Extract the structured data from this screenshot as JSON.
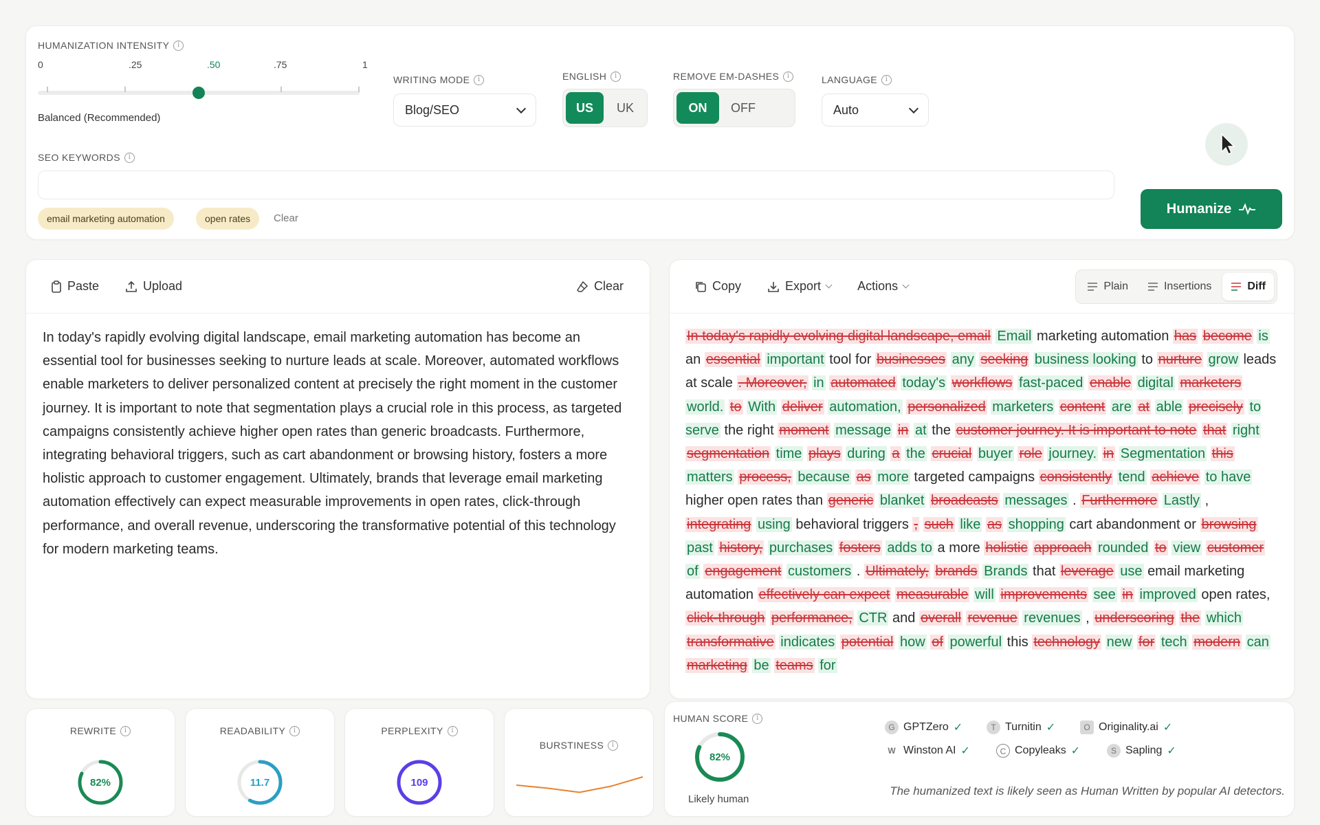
{
  "settings": {
    "intensity_label": "HUMANIZATION INTENSITY",
    "ticks": [
      "0",
      ".25",
      ".50",
      ".75",
      "1"
    ],
    "intensity_value": 0.5,
    "intensity_desc": "Balanced (Recommended)",
    "writing_mode_label": "WRITING MODE",
    "writing_mode_value": "Blog/SEO",
    "english_label": "ENGLISH",
    "english_options": [
      "US",
      "UK"
    ],
    "english_selected": "US",
    "em_dash_label": "REMOVE EM-DASHES",
    "em_dash_options": [
      "ON",
      "OFF"
    ],
    "em_dash_selected": "ON",
    "language_label": "LANGUAGE",
    "language_value": "Auto",
    "seo_label": "SEO KEYWORDS",
    "seo_placeholder": "",
    "keywords": [
      "email marketing automation",
      "open rates"
    ],
    "clear_label": "Clear",
    "humanize_label": "Humanize"
  },
  "left": {
    "paste": "Paste",
    "upload": "Upload",
    "clear": "Clear",
    "text": "In today's rapidly evolving digital landscape, email marketing automation has become an essential tool for businesses seeking to nurture leads at scale. Moreover, automated workflows enable marketers to deliver personalized content at precisely the right moment in the customer journey. It is important to note that segmentation plays a crucial role in this process, as targeted campaigns consistently achieve higher open rates than generic broadcasts. Furthermore, integrating behavioral triggers, such as cart abandonment or browsing history, fosters a more holistic approach to customer engagement. Ultimately, brands that leverage email marketing automation effectively can expect measurable improvements in open rates, click-through performance, and overall revenue, underscoring the transformative potential of this technology for modern marketing teams."
  },
  "right": {
    "copy": "Copy",
    "export": "Export",
    "actions": "Actions",
    "views": [
      "Plain",
      "Insertions",
      "Diff"
    ],
    "active_view": "Diff",
    "diff": [
      [
        "d",
        "In today's rapidly evolving digital landscape, email"
      ],
      [
        "i",
        "Email"
      ],
      [
        "t",
        "marketing automation"
      ],
      [
        "d",
        "has"
      ],
      [
        "d",
        "become"
      ],
      [
        "i",
        "is"
      ],
      [
        "t",
        "an"
      ],
      [
        "d",
        "essential"
      ],
      [
        "i",
        "important"
      ],
      [
        "t",
        "tool for"
      ],
      [
        "d",
        "businesses"
      ],
      [
        "i",
        "any"
      ],
      [
        "d",
        "seeking"
      ],
      [
        "i",
        "business looking"
      ],
      [
        "t",
        "to"
      ],
      [
        "d",
        "nurture"
      ],
      [
        "i",
        "grow"
      ],
      [
        "t",
        "leads at scale"
      ],
      [
        "d",
        ". Moreover,"
      ],
      [
        "i",
        "in"
      ],
      [
        "d",
        "automated"
      ],
      [
        "i",
        "today's"
      ],
      [
        "d",
        "workflows"
      ],
      [
        "i",
        "fast-paced"
      ],
      [
        "d",
        "enable"
      ],
      [
        "i",
        "digital"
      ],
      [
        "d",
        "marketers"
      ],
      [
        "i",
        "world."
      ],
      [
        "d",
        "to"
      ],
      [
        "i",
        "With"
      ],
      [
        "d",
        "deliver"
      ],
      [
        "i",
        "automation,"
      ],
      [
        "d",
        "personalized"
      ],
      [
        "i",
        "marketers"
      ],
      [
        "d",
        "content"
      ],
      [
        "i",
        "are"
      ],
      [
        "d",
        "at"
      ],
      [
        "i",
        "able"
      ],
      [
        "d",
        "precisely"
      ],
      [
        "i",
        "to serve"
      ],
      [
        "t",
        "the right"
      ],
      [
        "d",
        "moment"
      ],
      [
        "i",
        "message"
      ],
      [
        "d",
        "in"
      ],
      [
        "i",
        "at"
      ],
      [
        "t",
        "the"
      ],
      [
        "d",
        "customer journey. It is important to note"
      ],
      [
        "d",
        "that"
      ],
      [
        "i",
        "right"
      ],
      [
        "d",
        "segmentation"
      ],
      [
        "i",
        "time"
      ],
      [
        "d",
        "plays"
      ],
      [
        "i",
        "during"
      ],
      [
        "d",
        "a"
      ],
      [
        "i",
        "the"
      ],
      [
        "d",
        "crucial"
      ],
      [
        "i",
        "buyer"
      ],
      [
        "d",
        "role"
      ],
      [
        "i",
        "journey."
      ],
      [
        "d",
        "in"
      ],
      [
        "i",
        "Segmentation"
      ],
      [
        "d",
        "this"
      ],
      [
        "i",
        "matters"
      ],
      [
        "d",
        "process,"
      ],
      [
        "i",
        "because"
      ],
      [
        "d",
        "as"
      ],
      [
        "i",
        "more"
      ],
      [
        "t",
        "targeted campaigns"
      ],
      [
        "d",
        "consistently"
      ],
      [
        "i",
        "tend"
      ],
      [
        "d",
        "achieve"
      ],
      [
        "i",
        "to have"
      ],
      [
        "t",
        "higher open rates than"
      ],
      [
        "d",
        "generic"
      ],
      [
        "i",
        "blanket"
      ],
      [
        "d",
        "broadcasts"
      ],
      [
        "i",
        "messages"
      ],
      [
        "t",
        "."
      ],
      [
        "d",
        "Furthermore"
      ],
      [
        "i",
        "Lastly"
      ],
      [
        "t",
        ","
      ],
      [
        "d",
        "integrating"
      ],
      [
        "i",
        "using"
      ],
      [
        "t",
        "behavioral triggers"
      ],
      [
        "d",
        ","
      ],
      [
        "d",
        "such"
      ],
      [
        "i",
        "like"
      ],
      [
        "d",
        "as"
      ],
      [
        "i",
        "shopping"
      ],
      [
        "t",
        "cart abandonment or"
      ],
      [
        "d",
        "browsing"
      ],
      [
        "i",
        "past"
      ],
      [
        "d",
        "history,"
      ],
      [
        "i",
        "purchases"
      ],
      [
        "d",
        "fosters"
      ],
      [
        "i",
        "adds to"
      ],
      [
        "t",
        "a more"
      ],
      [
        "d",
        "holistic"
      ],
      [
        "d",
        "approach"
      ],
      [
        "i",
        "rounded"
      ],
      [
        "d",
        "to"
      ],
      [
        "i",
        "view"
      ],
      [
        "d",
        "customer"
      ],
      [
        "i",
        "of"
      ],
      [
        "d",
        "engagement"
      ],
      [
        "i",
        "customers"
      ],
      [
        "t",
        "."
      ],
      [
        "d",
        "Ultimately,"
      ],
      [
        "d",
        "brands"
      ],
      [
        "i",
        "Brands"
      ],
      [
        "t",
        "that"
      ],
      [
        "d",
        "leverage"
      ],
      [
        "i",
        "use"
      ],
      [
        "t",
        "email marketing automation"
      ],
      [
        "d",
        "effectively can expect"
      ],
      [
        "d",
        "measurable"
      ],
      [
        "i",
        "will"
      ],
      [
        "d",
        "improvements"
      ],
      [
        "i",
        "see"
      ],
      [
        "d",
        "in"
      ],
      [
        "i",
        "improved"
      ],
      [
        "t",
        "open rates,"
      ],
      [
        "d",
        "click-through"
      ],
      [
        "d",
        "performance,"
      ],
      [
        "i",
        "CTR"
      ],
      [
        "t",
        "and"
      ],
      [
        "d",
        "overall"
      ],
      [
        "d",
        "revenue"
      ],
      [
        "i",
        "revenues"
      ],
      [
        "t",
        ","
      ],
      [
        "d",
        "underscoring"
      ],
      [
        "d",
        "the"
      ],
      [
        "i",
        "which"
      ],
      [
        "d",
        "transformative"
      ],
      [
        "i",
        "indicates"
      ],
      [
        "d",
        "potential"
      ],
      [
        "i",
        "how"
      ],
      [
        "d",
        "of"
      ],
      [
        "i",
        "powerful"
      ],
      [
        "t",
        "this"
      ],
      [
        "d",
        "technology"
      ],
      [
        "i",
        "new"
      ],
      [
        "d",
        "for"
      ],
      [
        "i",
        "tech"
      ],
      [
        "d",
        "modern"
      ],
      [
        "i",
        "can"
      ],
      [
        "d",
        "marketing"
      ],
      [
        "i",
        "be"
      ],
      [
        "d",
        "teams"
      ],
      [
        "i",
        "for"
      ]
    ]
  },
  "stats": {
    "rewrite_label": "REWRITE",
    "rewrite_value": "82%",
    "rewrite_pct": 82,
    "readability_label": "READABILITY",
    "readability_value": "11.7",
    "readability_pct": 58,
    "perplexity_label": "PERPLEXITY",
    "perplexity_value": "109",
    "perplexity_pct": 100,
    "burstiness_label": "BURSTINESS",
    "burstiness_series": [
      0.5,
      0.35,
      0.15,
      0.45,
      0.9
    ],
    "human_label": "HUMAN SCORE",
    "human_value": "82%",
    "human_pct": 82,
    "human_desc": "Likely human",
    "detectors": [
      "GPTZero",
      "Turnitin",
      "Originality.ai",
      "Winston AI",
      "Copyleaks",
      "Sapling"
    ],
    "detector_note": "The humanized text is likely seen as Human Written by popular AI detectors."
  },
  "colors": {
    "accent": "#128457",
    "rewrite": "#1a8a55",
    "readability": "#2a9fc4",
    "perplexity": "#5b3ee8",
    "burstiness": "#e8822f"
  }
}
